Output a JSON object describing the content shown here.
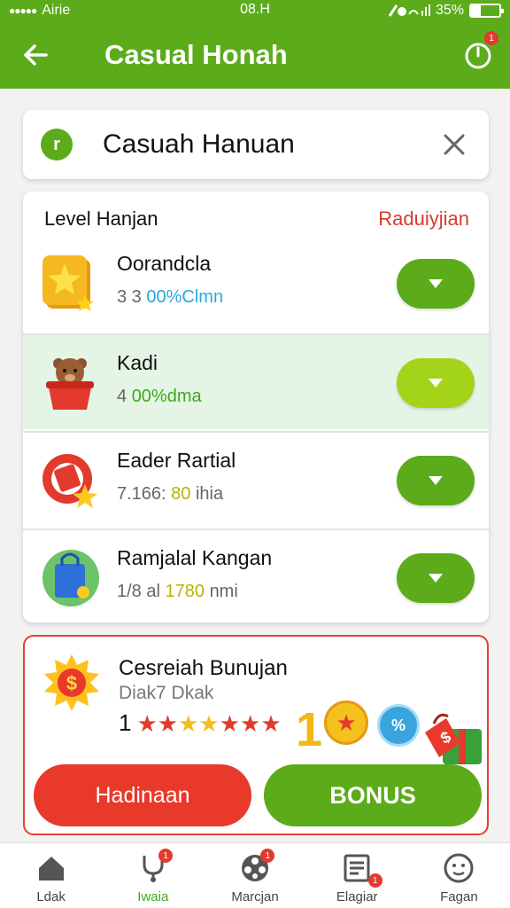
{
  "status_bar": {
    "carrier": "Airie",
    "time": "08.H",
    "battery_text": "35%",
    "battery_level": 0.35
  },
  "app_bar": {
    "title": "Casual Honah",
    "timer_badge": "1"
  },
  "search": {
    "value": "Casuah Hanuan",
    "icon_letter": "r"
  },
  "list": {
    "header_left": "Level Hanjan",
    "header_right": "Raduiyjian",
    "items": [
      {
        "title": "Oorandcla",
        "sub_prefix": "3 3",
        "sub_highlight": "00%Clmn",
        "icon": "star-block-icon"
      },
      {
        "title": "Kadi",
        "sub_prefix": "4",
        "sub_highlight": "00%dma",
        "icon": "bear-pot-icon"
      },
      {
        "title": "Eader Rartial",
        "sub_prefix": "7.166:",
        "sub_highlight": "80",
        "sub_suffix": "ihia",
        "icon": "ring-star-icon"
      },
      {
        "title": "Ramjalal Kangan",
        "sub_prefix": "1/8 al",
        "sub_highlight": "1780",
        "sub_suffix": "nmi",
        "icon": "shopping-bag-icon"
      }
    ]
  },
  "bonus": {
    "title": "Cesreiah Bunujan",
    "subtitle": "Diak7 Dkak",
    "count": "1",
    "big_number": "1",
    "coin_symbol": "★",
    "percent_badge": "%",
    "btn_left": "Hadinaan",
    "btn_right": "BONUS"
  },
  "bottom_nav": [
    {
      "label": "Ldak",
      "icon": "home-icon",
      "badge": ""
    },
    {
      "label": "Iwaia",
      "icon": "stethoscope-icon",
      "badge": "1"
    },
    {
      "label": "Marcjan",
      "icon": "film-reel-icon",
      "badge": "1"
    },
    {
      "label": "Elagiar",
      "icon": "document-icon",
      "badge": "1"
    },
    {
      "label": "Fagan",
      "icon": "smiley-icon",
      "badge": ""
    }
  ],
  "colors": {
    "primary_green": "#5bab1a",
    "accent_red": "#e8392a",
    "lime": "#a4d41a"
  }
}
